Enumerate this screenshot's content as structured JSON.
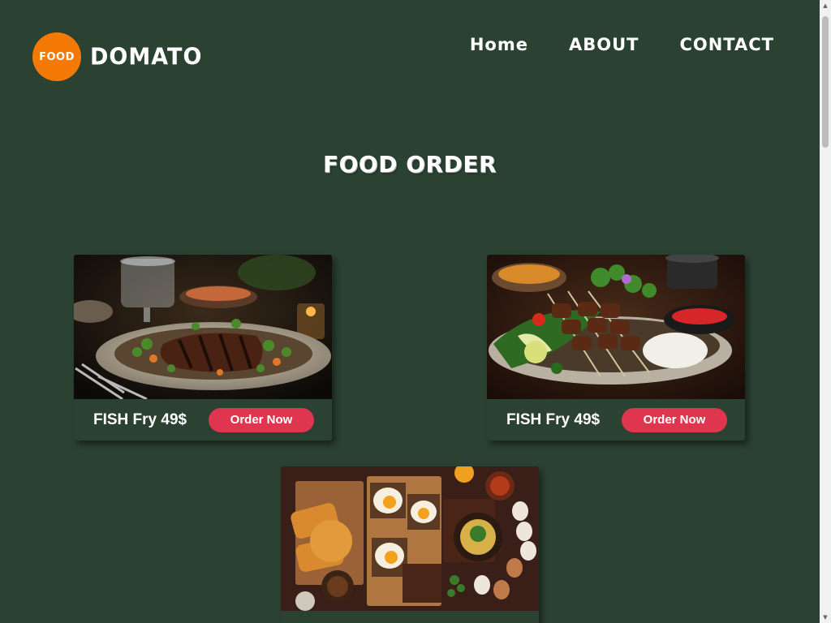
{
  "header": {
    "logo_badge": "FOOD",
    "logo_text": "DOMATO",
    "nav": [
      {
        "label": "Home"
      },
      {
        "label": "ABOUT"
      },
      {
        "label": "CONTACT"
      }
    ]
  },
  "main": {
    "title": "FOOD ORDER",
    "cards": [
      {
        "name": "FISH Fry 49$",
        "button": "Order Now",
        "image": "grilled-steak-plate"
      },
      {
        "name": "FISH Fry 49$",
        "button": "Order Now",
        "image": "chicken-skewers-plate"
      },
      {
        "name": "",
        "button": "",
        "image": "breakfast-eggs-board"
      }
    ]
  },
  "colors": {
    "background": "#2b4233",
    "logo_orange": "#f57a05",
    "button_red": "#e0354f"
  }
}
